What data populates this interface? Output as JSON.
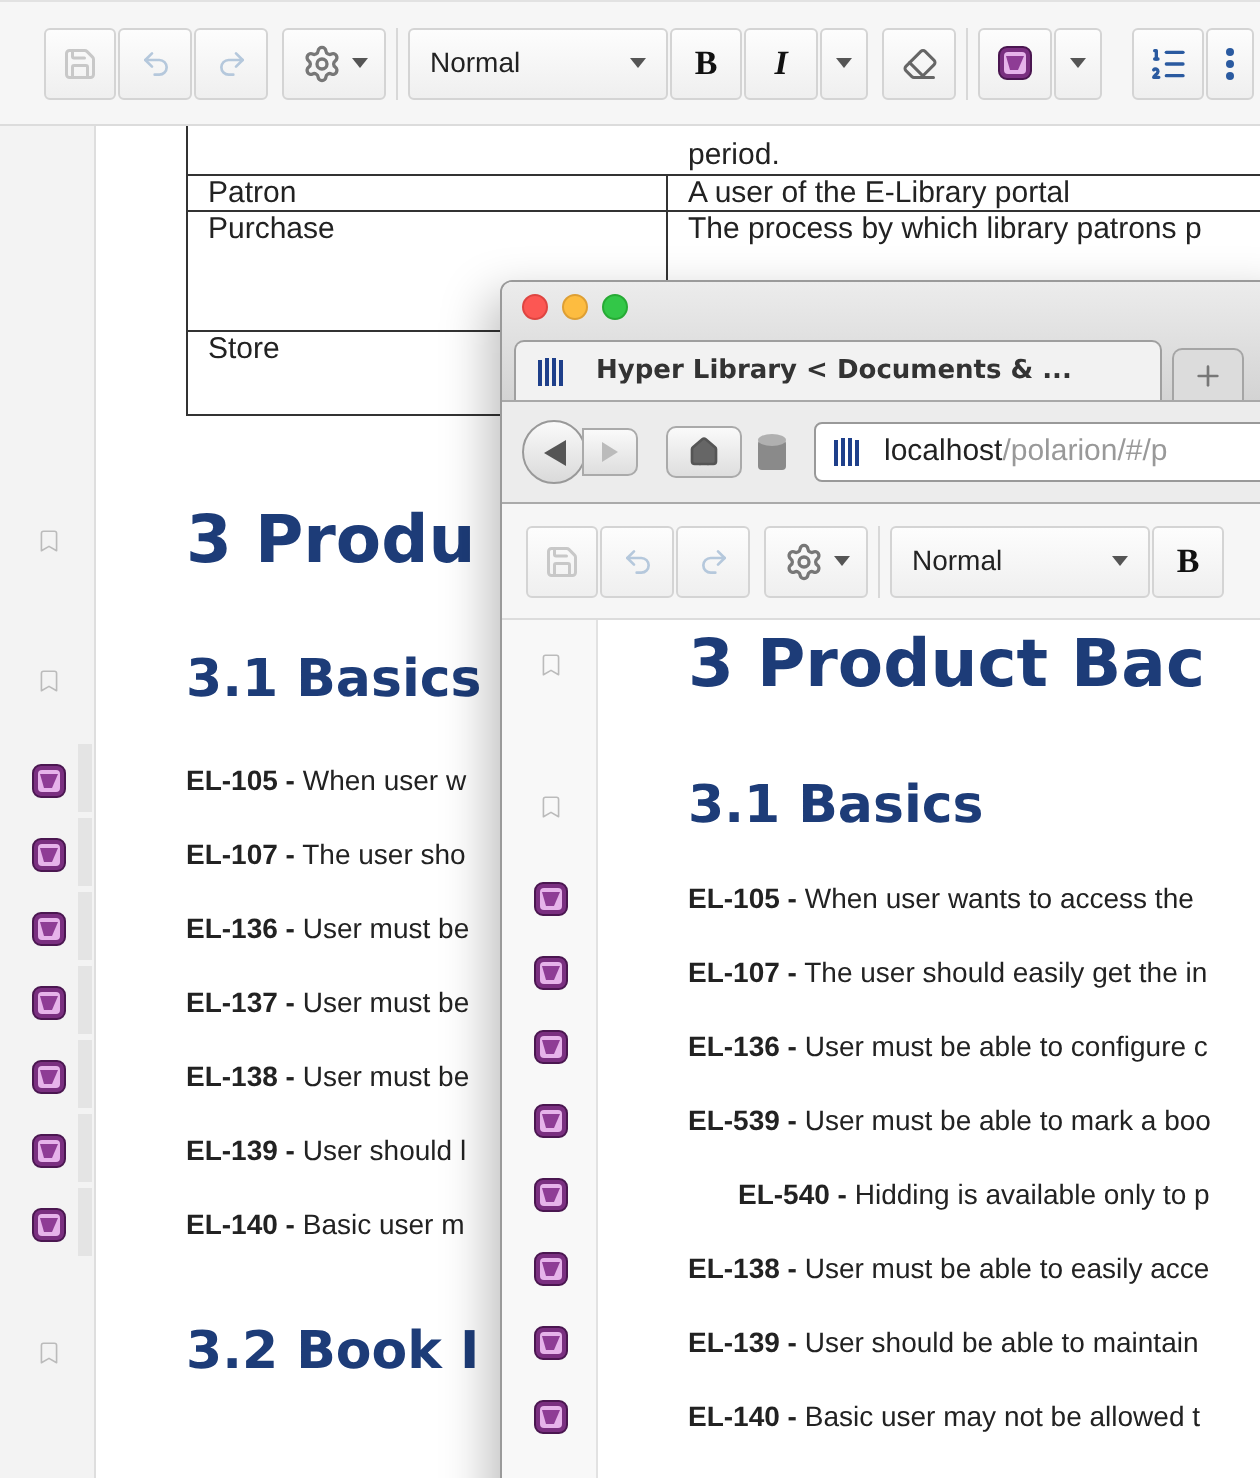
{
  "editor": {
    "toolbar": [
      {
        "kind": "save",
        "disabled": true
      },
      {
        "kind": "undo",
        "disabled": true
      },
      {
        "kind": "redo",
        "disabled": true
      },
      {
        "kind": "settings",
        "disabled": false
      },
      {
        "kind": "separator"
      },
      {
        "kind": "style-select",
        "label": "Normal"
      },
      {
        "kind": "bold",
        "label": "B"
      },
      {
        "kind": "italic",
        "label": "I"
      },
      {
        "kind": "caret"
      },
      {
        "kind": "eraser"
      },
      {
        "kind": "separator"
      },
      {
        "kind": "requirement"
      },
      {
        "kind": "caret"
      },
      {
        "kind": "list"
      },
      {
        "kind": "more"
      }
    ],
    "glossary": [
      {
        "definition": "period."
      },
      {
        "term": "Patron",
        "definition": "A user of the E-Library portal"
      },
      {
        "term": "Purchase",
        "definition": "The process by which library patrons p"
      },
      {
        "term": "Store"
      }
    ],
    "blocks": [
      {
        "kind": "heading1",
        "text": "3 Produ"
      },
      {
        "kind": "heading2",
        "text": "3.1 Basics"
      },
      {
        "kind": "requirement",
        "text": "**EL-105 -** When user w"
      },
      {
        "kind": "requirement",
        "text": "**EL-107 -** The user sho"
      },
      {
        "kind": "requirement",
        "text": "**EL-136 -** User must be"
      },
      {
        "kind": "requirement",
        "text": "**EL-137 -** User must be"
      },
      {
        "kind": "requirement",
        "text": "**EL-138 -** User must be"
      },
      {
        "kind": "requirement",
        "text": "**EL-139 -** User should l"
      },
      {
        "kind": "requirement",
        "text": "**EL-140 -** Basic user m"
      },
      {
        "kind": "heading2",
        "text": "3.2 Book I"
      }
    ]
  },
  "browser": {
    "tab": {
      "title": "Hyper Library < Documents & ...",
      "selected": true
    },
    "url": {
      "host": "localhost",
      "path": "/polarion/#/p"
    },
    "toolbar": [
      {
        "kind": "save",
        "disabled": true
      },
      {
        "kind": "undo",
        "disabled": true
      },
      {
        "kind": "redo",
        "disabled": true
      },
      {
        "kind": "settings",
        "disabled": false
      },
      {
        "kind": "separator"
      },
      {
        "kind": "style-select",
        "label": "Normal"
      },
      {
        "kind": "bold",
        "label": "B"
      }
    ],
    "blocks": [
      {
        "kind": "heading1",
        "text": "3 Product Bac"
      },
      {
        "kind": "heading2",
        "text": "3.1 Basics"
      },
      {
        "kind": "requirement",
        "text": "**EL-105 -** When user wants to access the"
      },
      {
        "kind": "requirement",
        "text": "**EL-107 -** The user should easily get the in"
      },
      {
        "kind": "requirement",
        "text": "**EL-136 -** User must be able to configure c"
      },
      {
        "kind": "requirement",
        "text": "**EL-539 -** User must be able to mark a boo",
        "children": [
          {
            "kind": "requirement",
            "text": "**EL-540 -** Hidding is available only to p"
          }
        ]
      },
      {
        "kind": "requirement",
        "text": "**EL-138 -** User must be able to easily acce"
      },
      {
        "kind": "requirement",
        "text": "**EL-139 -** User should be able to maintain"
      },
      {
        "kind": "requirement",
        "text": "**EL-140 -** Basic user may not be allowed t"
      }
    ]
  }
}
